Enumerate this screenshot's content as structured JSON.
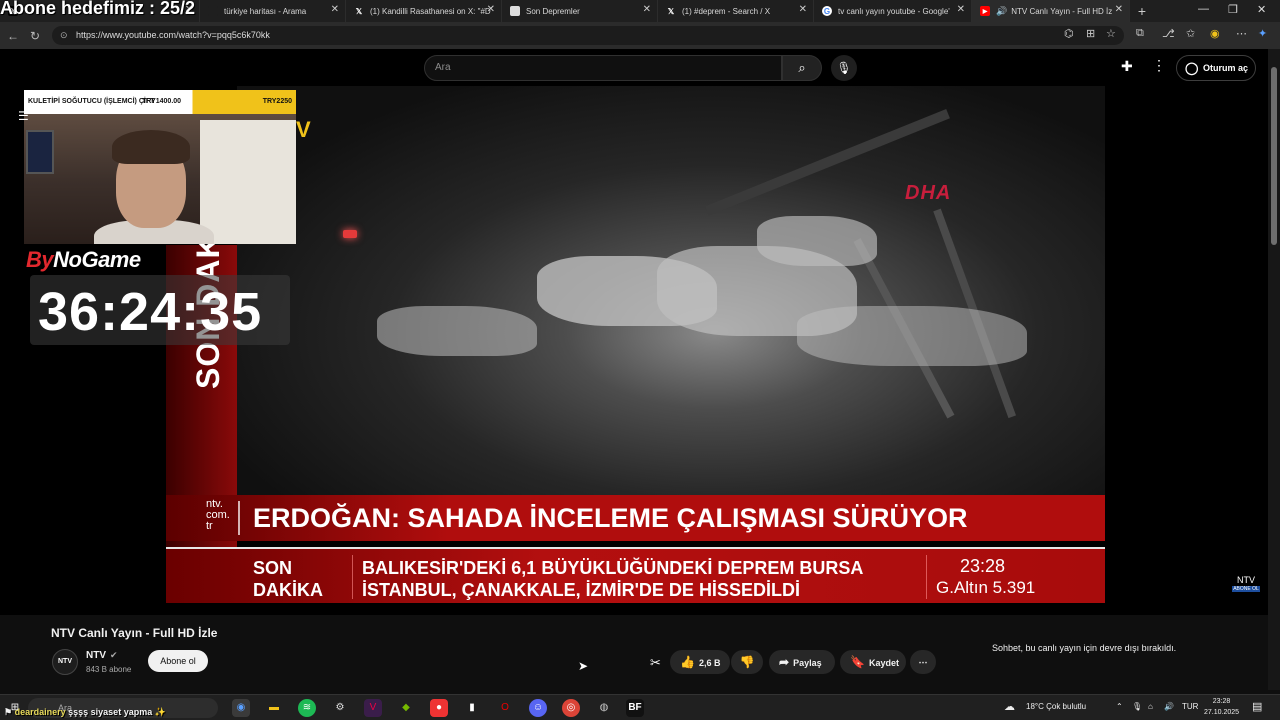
{
  "browser": {
    "tabs": [
      {
        "label": "",
        "icon": "x-icon"
      },
      {
        "label": "türkiye haritası - Arama",
        "icon": "bing-icon"
      },
      {
        "label": "(1) Kandilli Rasathanesi on X: \"#D",
        "icon": "x-icon"
      },
      {
        "label": "Son Depremler",
        "icon": "page-icon"
      },
      {
        "label": "(1) #deprem - Search / X",
        "icon": "x-icon"
      },
      {
        "label": "tv canlı yayın youtube - Google'",
        "icon": "google-icon"
      },
      {
        "label": "NTV Canlı Yayın - Full HD İz",
        "icon": "youtube-icon"
      }
    ],
    "url": "https://www.youtube.com/watch?v=pqq5c6k70kk"
  },
  "stream_overlay": {
    "subscriber_goal": "Abone hedefimiz : 25/2",
    "cam_bar_left": "KULETİPİ SOĞUTUCU (İŞLEMCİ) ÇİFT",
    "cam_bar_mid": "TRY1400.00",
    "cam_bar_right": "TRY2250",
    "sponsor_prefix": "By",
    "sponsor_rest": "NoGame",
    "timer": "36:24:35",
    "v_mark": "V"
  },
  "youtube": {
    "search_placeholder": "Ara",
    "signin_label": "Oturum aç",
    "video_title": "NTV Canlı Yayın - Full HD İzle",
    "channel_name": "NTV",
    "channel_avatar": "NTV",
    "subscribers": "843 B abone",
    "subscribe_label": "Abone ol",
    "like_count": "2,6 B",
    "share_label": "Paylaş",
    "save_label": "Kaydet",
    "chat_disabled": "Sohbet, bu canlı yayın için devre dışı bırakıldı."
  },
  "broadcast": {
    "watermark": "DHA",
    "vertical_label": "SON DAKİ",
    "brand_line1": "ntv.",
    "brand_line2": "com.",
    "brand_line3": "tr",
    "headline": "ERDOĞAN: SAHADA İNCELEME ÇALIŞMASI SÜRÜYOR",
    "ticker_label_1": "SON",
    "ticker_label_2": "DAKİKA",
    "ticker_line_1": "BALIKESİR'DEKİ 6,1 BÜYÜKLÜĞÜNDEKİ DEPREM BURSA",
    "ticker_line_2": "İSTANBUL, ÇANAKKALE, İZMİR'DE DE HİSSEDİLDİ",
    "clock": "23:28",
    "gold": "G.Altın 5.391",
    "corner_logo": "NTV",
    "corner_logo_sub": "ABONE OL"
  },
  "taskbar": {
    "search_placeholder": "Ara",
    "weather": "18°C  Çok bulutlu",
    "lang": "TUR",
    "time": "23:28",
    "date": "27.10.2025"
  },
  "chat_line": {
    "user": "deardainery",
    "message": "şşşş siyaset yapma"
  }
}
